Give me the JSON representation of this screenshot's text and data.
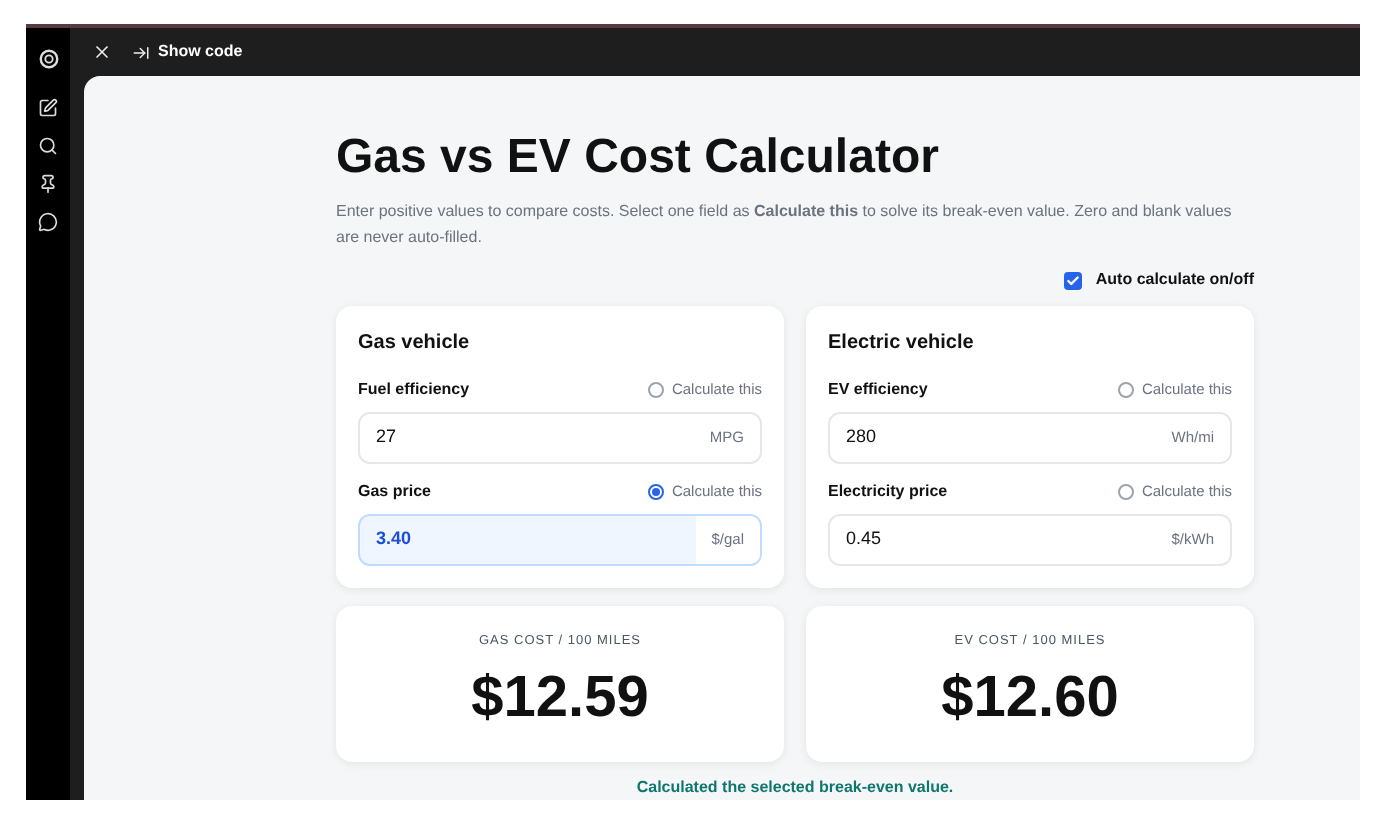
{
  "toolbar": {
    "action": "Show code"
  },
  "title": "Gas vs EV Cost Calculator",
  "intro": "Enter positive values to compare costs. Select one field as **Calculate this** to solve its break-even value. Zero and blank values are never auto-filled.",
  "auto_calculate": {
    "label": "Auto calculate on/off",
    "checked": true
  },
  "vehicles": [
    {
      "title": "Gas vehicle",
      "fields": [
        {
          "label": "Fuel efficiency",
          "option": "Calculate this",
          "selected": false,
          "value": "27",
          "unit": "MPG"
        },
        {
          "label": "Gas price",
          "option": "Calculate this",
          "selected": true,
          "value": "3.40",
          "unit": "$/gal"
        }
      ]
    },
    {
      "title": "Electric vehicle",
      "fields": [
        {
          "label": "EV efficiency",
          "option": "Calculate this",
          "selected": false,
          "value": "280",
          "unit": "Wh/mi"
        },
        {
          "label": "Electricity price",
          "option": "Calculate this",
          "selected": false,
          "value": "0.45",
          "unit": "$/kWh"
        }
      ]
    }
  ],
  "results": [
    {
      "label": "GAS COST / 100 MILES",
      "value": "$12.59"
    },
    {
      "label": "EV COST / 100 MILES",
      "value": "$12.60"
    }
  ],
  "status": "Calculated the selected break-even value."
}
